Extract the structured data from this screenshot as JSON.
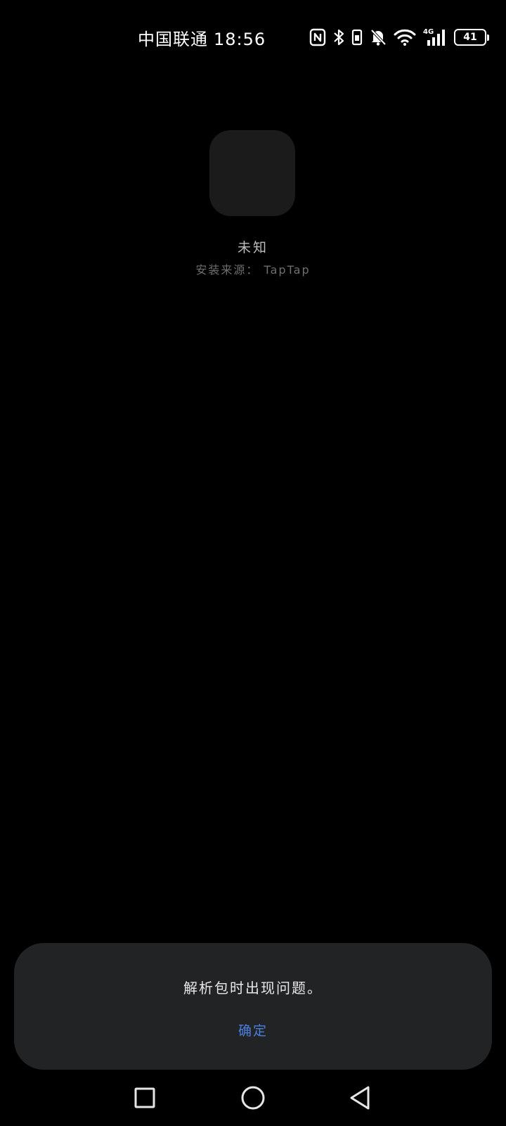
{
  "status_bar": {
    "carrier": "中国联通",
    "time": "18:56",
    "network": "4G",
    "battery_level": "41",
    "icons": [
      "nfc-icon",
      "bluetooth-icon",
      "vibrate-icon",
      "bell-off-icon",
      "wifi-icon",
      "signal-icon",
      "battery-icon"
    ]
  },
  "app": {
    "name": "未知",
    "source": "安装来源： TapTap"
  },
  "dialog": {
    "message": "解析包时出现问题。",
    "confirm_label": "确定",
    "accent_color": "#4a7fe0"
  },
  "nav_bar": {
    "icons": [
      "recents-icon",
      "home-icon",
      "back-icon"
    ]
  }
}
